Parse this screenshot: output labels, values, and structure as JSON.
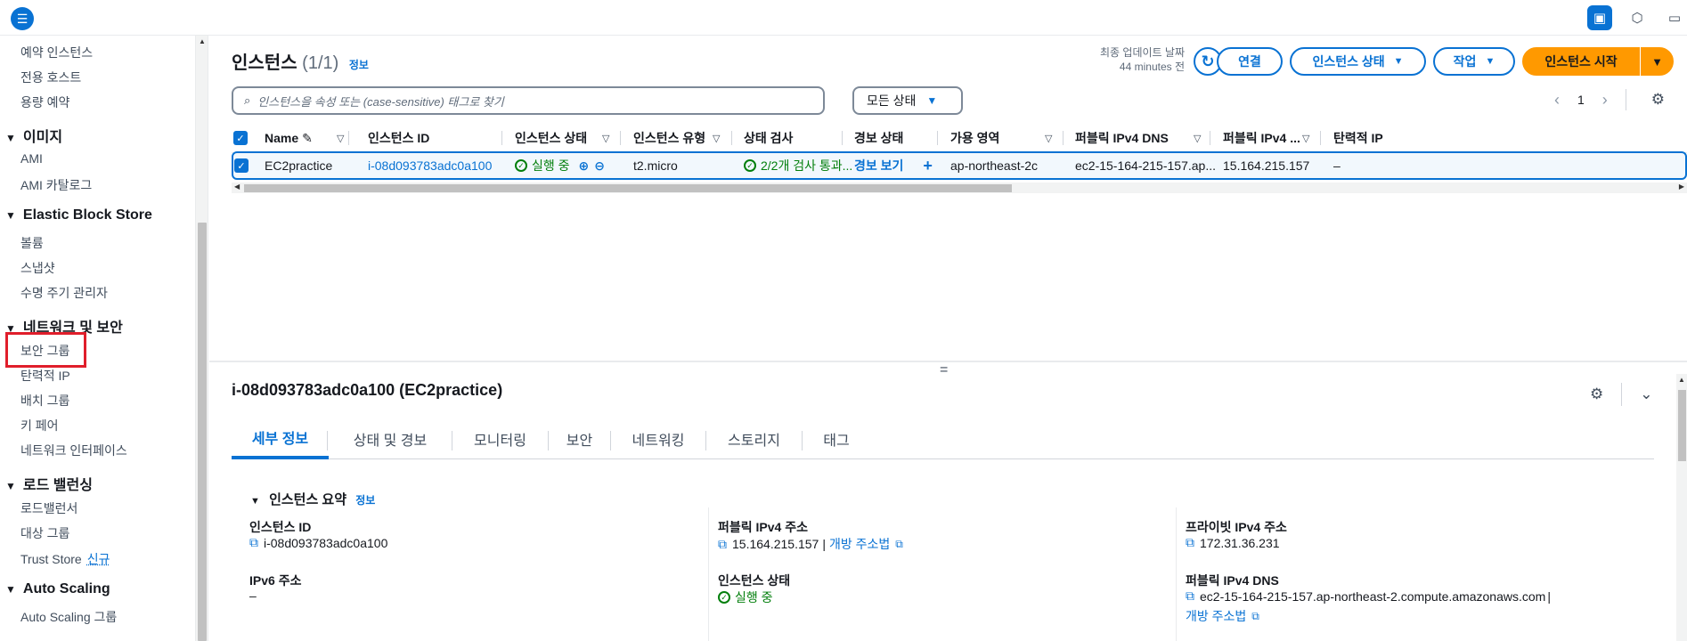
{
  "topbar": {
    "menu_icon": "☰",
    "icons": [
      "panel-icon",
      "hex-icon",
      "monitor-icon"
    ]
  },
  "sidebar": {
    "items": {
      "reserved_instances": "예약 인스턴스",
      "dedicated_hosts": "전용 호스트",
      "capacity_reservations": "용량 예약",
      "images_head": "이미지",
      "ami": "AMI",
      "ami_catalog": "AMI 카탈로그",
      "ebs_head": "Elastic Block Store",
      "volumes": "볼륨",
      "snapshots": "스냅샷",
      "lifecycle_manager": "수명 주기 관리자",
      "network_head": "네트워크 및 보안",
      "security_groups": "보안 그룹",
      "elastic_ip": "탄력적 IP",
      "placement_groups": "배치 그룹",
      "key_pairs": "키 페어",
      "network_interfaces": "네트워크 인터페이스",
      "lb_head": "로드 밸런싱",
      "load_balancers": "로드밸런서",
      "target_groups": "대상 그룹",
      "trust_store": "Trust Store",
      "trust_store_badge": "신규",
      "as_head": "Auto Scaling",
      "as_groups": "Auto Scaling 그룹"
    }
  },
  "header": {
    "title": "인스턴스",
    "count": "(1/1)",
    "info": "정보",
    "last_update_label": "최종 업데이트 날짜",
    "last_update_value": "44 minutes 전",
    "connect_btn": "연결",
    "state_btn": "인스턴스 상태",
    "actions_btn": "작업",
    "launch_btn": "인스턴스 시작"
  },
  "filter": {
    "search_placeholder": "인스턴스을 속성 또는 (case-sensitive) 태그로 찾기",
    "state_select": "모든 상태",
    "page": "1"
  },
  "table": {
    "columns": [
      "Name",
      "인스턴스 ID",
      "인스턴스 상태",
      "인스턴스 유형",
      "상태 검사",
      "경보 상태",
      "가용 영역",
      "퍼블릭 IPv4 DNS",
      "퍼블릭 IPv4 ...",
      "탄력적 IP"
    ],
    "row": {
      "name": "EC2practice",
      "instance_id": "i-08d093783adc0a100",
      "state": "실행 중",
      "type": "t2.micro",
      "status_check": "2/2개 검사 통과...",
      "alarm": "경보 보기",
      "az": "ap-northeast-2c",
      "dns": "ec2-15-164-215-157.ap...",
      "ipv4": "15.164.215.157",
      "eip": "–"
    }
  },
  "detail": {
    "title": "i-08d093783adc0a100 (EC2practice)",
    "tabs": [
      "세부 정보",
      "상태 및 경보",
      "모니터링",
      "보안",
      "네트워킹",
      "스토리지",
      "태그"
    ],
    "section_title": "인스턴스 요약",
    "section_info": "정보",
    "instance_id_label": "인스턴스 ID",
    "instance_id_value": "i-08d093783adc0a100",
    "ipv6_label": "IPv6 주소",
    "ipv6_value": "–",
    "public_ipv4_label": "퍼블릭 IPv4 주소",
    "public_ipv4_value": "15.164.215.157",
    "open_address": "개방 주소법",
    "state_label": "인스턴스 상태",
    "state_value": "실행 중",
    "private_ipv4_label": "프라이빗 IPv4 주소",
    "private_ipv4_value": "172.31.36.231",
    "public_dns_label": "퍼블릭 IPv4 DNS",
    "public_dns_value": "ec2-15-164-215-157.ap-northeast-2.compute.amazonaws.com",
    "open_address_2": "개방 주소법"
  },
  "colors": {
    "accent": "#0972d3",
    "primary_button": "#ff9900",
    "success": "#037f0c",
    "highlight": "#e01e2b"
  }
}
